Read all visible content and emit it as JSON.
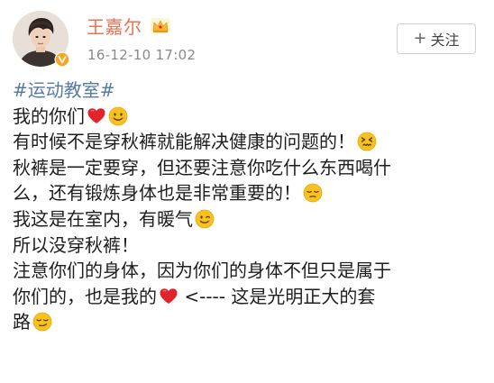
{
  "post": {
    "author": {
      "name": "王嘉尔",
      "timestamp": "16-12-10 17:02",
      "avatar_icon": "avatar-photo",
      "verify_icon": "verified-badge-icon",
      "vip_icon": "crown-vip-icon"
    },
    "follow_button": {
      "plus": "+",
      "label": "关注"
    },
    "hashtag": "#运动教室#",
    "lines": [
      {
        "text": "我的你们",
        "trailing_emojis": [
          "heart",
          "smile"
        ]
      },
      {
        "text": "有时候不是穿秋裤就能解决健康的问题的！",
        "trailing_emojis": [
          "confounded"
        ]
      },
      {
        "text": "秋裤是一定要穿，但还要注意你吃什么东西喝什",
        "trailing_emojis": []
      },
      {
        "text": "么，还有锻炼身体也是非常重要的！",
        "trailing_emojis": [
          "pensive"
        ]
      },
      {
        "text": "我这是在室内，有暖气",
        "trailing_emojis": [
          "wink"
        ]
      },
      {
        "text": "所以没穿秋裤！",
        "trailing_emojis": []
      },
      {
        "text": "注意你们的身体，因为你们的身体不但只是属于",
        "trailing_emojis": []
      },
      {
        "text_before": "你们的，也是我的",
        "inline_emoji": "heart",
        "text_after": " <---- 这是光明正大的套"
      },
      {
        "text": "路",
        "trailing_emojis": [
          "smirk"
        ]
      }
    ]
  },
  "colors": {
    "username": "#eb7350",
    "hashtag": "#5979a8",
    "timestamp": "#8a8a8a",
    "text": "#1e1e1e",
    "emoji_yellow": "#f7c21e",
    "heart_red": "#e0242b"
  }
}
